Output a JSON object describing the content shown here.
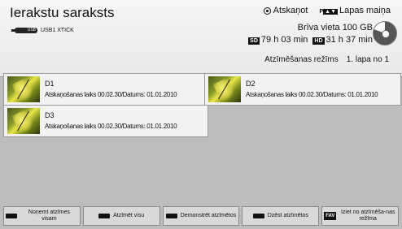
{
  "header": {
    "title": "Ierakstu saraksts",
    "device": "USB1 XTICK",
    "usb_icon_label": "USB",
    "legend_play": "Atskaņot",
    "legend_page": "Lapas maiņa",
    "legend_page_key": "P",
    "free_space": "Brīva vieta 100 GB",
    "sd_label": "SD",
    "sd_time": "79 h 03 min",
    "hd_label": "HD",
    "hd_time": "31 h 37 min",
    "mode": "Atzīmēšanas režīms",
    "page": "1. lapa no 1"
  },
  "files": [
    {
      "name": "D1",
      "meta": "Atskaņošanas laiks 00.02.30/Datums: 01.01.2010"
    },
    {
      "name": "D2",
      "meta": "Atskaņošanas laiks 00.02.30/Datums: 01.01.2010"
    },
    {
      "name": "D3",
      "meta": "Atskaņošanas laiks 00.02.30/Datums: 01.01.2010"
    }
  ],
  "footer": {
    "unmark_all": "Noņemt atzīmes visam",
    "mark_all": "Atzīmēt visu",
    "show_marked": "Demonstrēt atzīmētos",
    "delete_marked": "Dzēst atzīmētos",
    "fav_key": "FAV",
    "exit_mode": "Iziet no atzīmēša-nas režīma"
  },
  "icons": [
    "usb-icon",
    "play-radio-icon",
    "page-key-icon",
    "disc-usage-icon",
    "thumbnail-icon"
  ],
  "colors": {
    "header_bg": "#efefef",
    "panel_bg": "#bdbdbd",
    "key": "#111111"
  }
}
